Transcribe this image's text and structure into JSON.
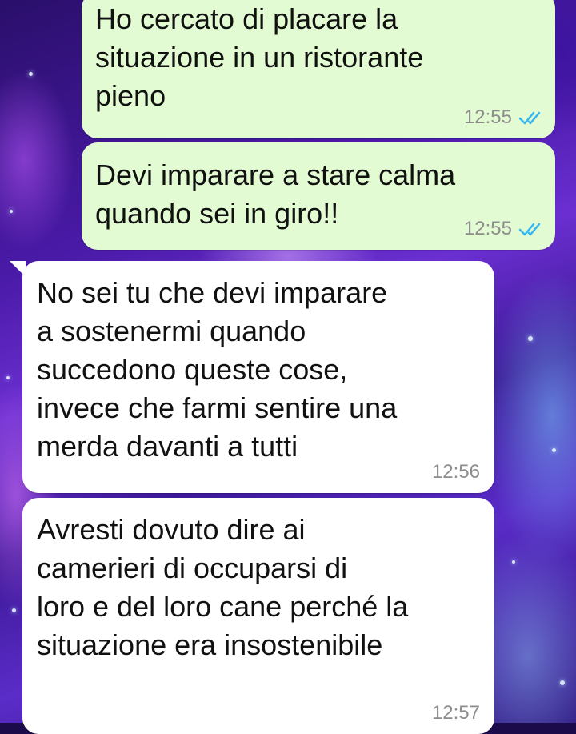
{
  "theme": {
    "outgoing_bubble_color": "#e3fbd2",
    "incoming_bubble_color": "#ffffff",
    "timestamp_color": "#8d8d8d",
    "read_tick_color": "#34b7f1"
  },
  "messages": [
    {
      "direction": "outgoing",
      "text": "Ho cercato di placare la\nsituazione in un ristorante\npieno",
      "time": "12:55",
      "status_icon": "double-check-read-icon"
    },
    {
      "direction": "outgoing",
      "text": "Devi imparare a stare calma\nquando sei in giro!!",
      "time": "12:55",
      "status_icon": "double-check-read-icon"
    },
    {
      "direction": "incoming",
      "text": "No sei tu che devi imparare\na sostenermi quando\nsuccedono queste cose,\ninvece che farmi sentire una\nmerda davanti a tutti",
      "time": "12:56"
    },
    {
      "direction": "incoming",
      "text": "Avresti dovuto dire ai\ncamerieri di occuparsi di\nloro e del loro cane perché la\nsituazione era insostenibile",
      "time": "12:57"
    }
  ]
}
